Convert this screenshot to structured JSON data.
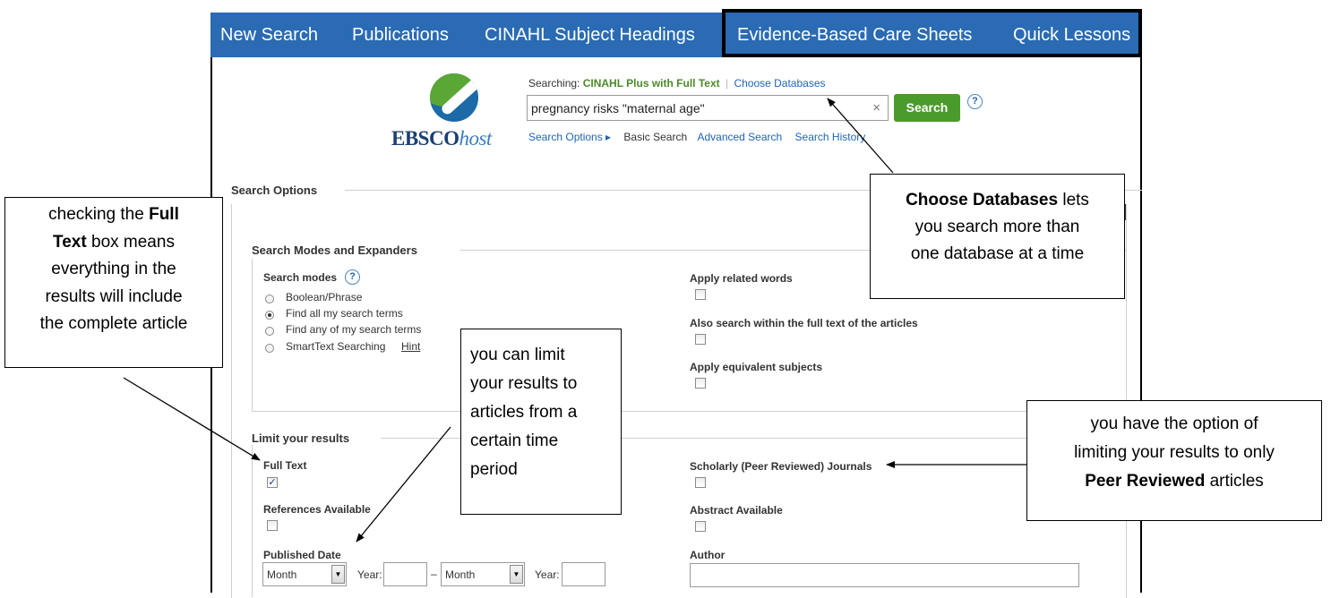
{
  "nav": {
    "items": [
      "New Search",
      "Publications",
      "CINAHL Subject Headings",
      "Evidence-Based Care Sheets",
      "Quick Lessons"
    ]
  },
  "logo": {
    "brand": "EBSCO",
    "suffix": "host"
  },
  "search": {
    "searching_label": "Searching:",
    "database": "CINAHL Plus with Full Text",
    "choose_databases": "Choose Databases",
    "query": "pregnancy risks \"maternal age\"",
    "clear": "×",
    "button": "Search",
    "help": "?",
    "links": {
      "options": "Search Options ▸",
      "basic": "Basic Search",
      "advanced": "Advanced Search",
      "history": "Search History"
    }
  },
  "options": {
    "title": "Search Options",
    "modes_section": "Search Modes and Expanders",
    "modes_label": "Search modes",
    "modes": [
      {
        "label": "Boolean/Phrase",
        "selected": false
      },
      {
        "label": "Find all my search terms",
        "selected": true
      },
      {
        "label": "Find any of my search terms",
        "selected": false
      },
      {
        "label": "SmartText Searching",
        "selected": false
      }
    ],
    "hint": "Hint",
    "expanders": [
      {
        "label": "Apply related words",
        "checked": false
      },
      {
        "label": "Also search within the full text of the articles",
        "checked": false
      },
      {
        "label": "Apply equivalent subjects",
        "checked": false
      }
    ]
  },
  "limits": {
    "title": "Limit your results",
    "full_text": {
      "label": "Full Text",
      "checked": true
    },
    "references": {
      "label": "References Available",
      "checked": false
    },
    "published_date": "Published Date",
    "month_placeholder": "Month",
    "year_label": "Year:",
    "dash": "–",
    "scholarly": {
      "label": "Scholarly (Peer Reviewed) Journals",
      "checked": false
    },
    "abstract": {
      "label": "Abstract Available",
      "checked": false
    },
    "author": "Author"
  },
  "callouts": {
    "full_text": {
      "t1": "checking the ",
      "b1": "Full",
      "b2": "Text",
      "t2": " box means",
      "l3": "everything in the",
      "l4": "results will include",
      "l5": "the complete article"
    },
    "time": {
      "l1": "you can limit",
      "l2": "your results to",
      "l3": "articles from a",
      "l4": "certain time",
      "l5": "period"
    },
    "databases": {
      "b1": "Choose Databases",
      "t1": " lets",
      "l2": "you search more than",
      "l3": "one database at a time"
    },
    "peer": {
      "l1": "you have the option of",
      "l2": "limiting your results to only",
      "b1": "Peer Reviewed",
      "t1": " articles"
    }
  }
}
